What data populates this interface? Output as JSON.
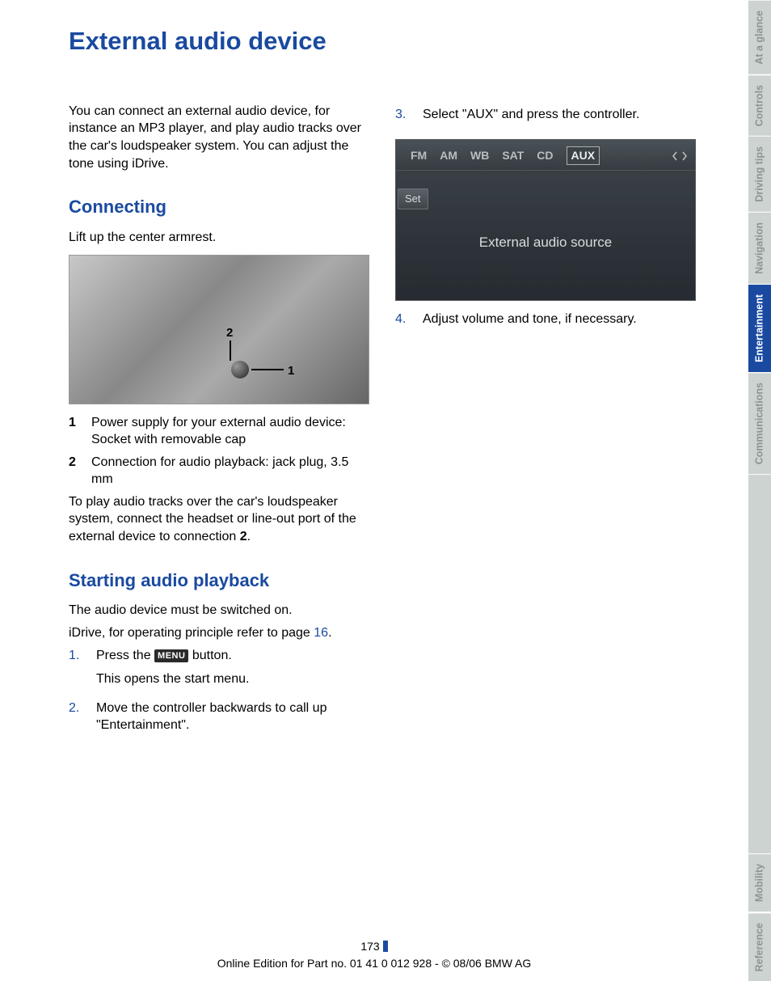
{
  "title": "External audio device",
  "intro": "You can connect an external audio device, for instance an MP3 player, and play audio tracks over the car's loudspeaker system. You can adjust the tone using iDrive.",
  "sections": {
    "connecting": {
      "heading": "Connecting",
      "lead": "Lift up the center armrest.",
      "definitions": [
        {
          "num": "1",
          "text": "Power supply for your external audio device:\nSocket with removable cap"
        },
        {
          "num": "2",
          "text": "Connection for audio playback: jack plug, 3.5 mm"
        }
      ],
      "note_pre": "To play audio tracks over the car's loudspeaker system, connect the headset or line-out port of the external device to connection ",
      "note_bold": "2",
      "note_post": "."
    },
    "starting": {
      "heading": "Starting audio playback",
      "p1": "The audio device must be switched on.",
      "p2_pre": "iDrive, for operating principle refer to page ",
      "p2_link": "16",
      "p2_post": ".",
      "steps": [
        {
          "idx": "1.",
          "line1_pre": "Press the ",
          "menu": "MENU",
          "line1_post": " button.",
          "line2": "This opens the start menu."
        },
        {
          "idx": "2.",
          "line1": "Move the controller backwards to call up \"Entertainment\"."
        },
        {
          "idx": "3.",
          "line1": "Select \"AUX\" and press the controller."
        },
        {
          "idx": "4.",
          "line1": "Adjust volume and tone, if necessary."
        }
      ]
    }
  },
  "aux_screenshot": {
    "tabs": [
      "FM",
      "AM",
      "WB",
      "SAT",
      "CD"
    ],
    "selected": "AUX",
    "set_label": "Set",
    "center_text": "External audio source"
  },
  "side_tabs": [
    {
      "label": "At a glance",
      "active": false
    },
    {
      "label": "Controls",
      "active": false
    },
    {
      "label": "Driving tips",
      "active": false
    },
    {
      "label": "Navigation",
      "active": false
    },
    {
      "label": "Entertainment",
      "active": true
    },
    {
      "label": "Communications",
      "active": false
    },
    {
      "label": "Mobility",
      "active": false
    },
    {
      "label": "Reference",
      "active": false
    }
  ],
  "footer": {
    "page": "173",
    "line": "Online Edition for Part no. 01 41 0 012 928 - © 08/06 BMW AG"
  },
  "armrest_labels": {
    "one": "1",
    "two": "2"
  }
}
